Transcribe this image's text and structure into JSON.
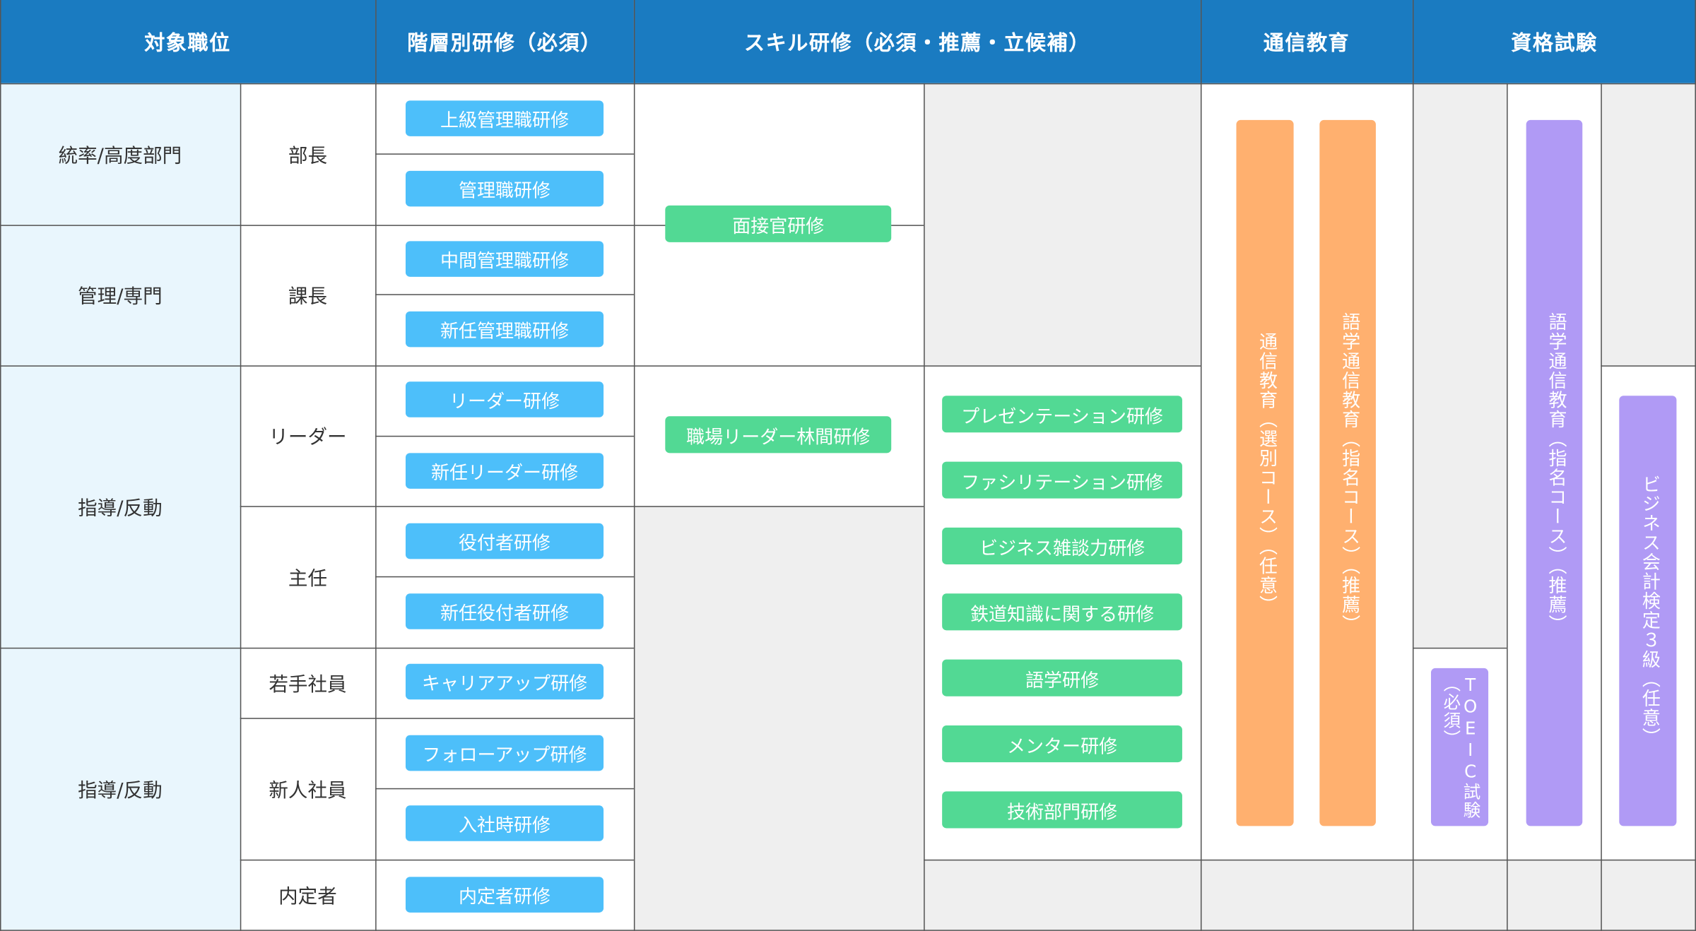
{
  "headers": {
    "position": "対象職位",
    "tier": "階層別研修（必須）",
    "skill": "スキル研修（必須・推薦・立候補）",
    "correspondence": "通信教育",
    "qualification": "資格試験"
  },
  "groups": [
    "統率/高度部門",
    "管理/専門",
    "指導/反動",
    "指導/反動"
  ],
  "roles": [
    "部長",
    "課長",
    "リーダー",
    "主任",
    "若手社員",
    "新人社員",
    "内定者"
  ],
  "tier_trainings": [
    "上級管理職研修",
    "管理職研修",
    "中間管理職研修",
    "新任管理職研修",
    "リーダー研修",
    "新任リーダー研修",
    "役付者研修",
    "新任役付者研修",
    "キャリアアップ研修",
    "フォローアップ研修",
    "入社時研修",
    "内定者研修"
  ],
  "skill_trainings": {
    "interviewer": "面接官研修",
    "leader_camp": "職場リーダー林間研修",
    "list": [
      "プレゼンテーション研修",
      "ファシリテーション研修",
      "ビジネス雑談力研修",
      "鉄道知識に関する研修",
      "語学研修",
      "メンター研修",
      "技術部門研修"
    ]
  },
  "correspondence_courses": [
    "通信教育（選別コース）（任意）",
    "語学通信教育（指名コース）（推薦）"
  ],
  "qualifications": {
    "toeic": "TOEIC試験\n（必須）",
    "language": "語学通信教育（指名コース）（推薦）",
    "accounting": "ビジネス会計検定３級（任意）"
  },
  "colors": {
    "header": "#1a7bc1",
    "position_bg": "#e9f6fd",
    "tier_pill": "#4dbffa",
    "skill_pill": "#52d994",
    "correspondence_bar": "#ffb06f",
    "qualification_bar": "#b09af5",
    "empty_cell": "#efefef"
  }
}
